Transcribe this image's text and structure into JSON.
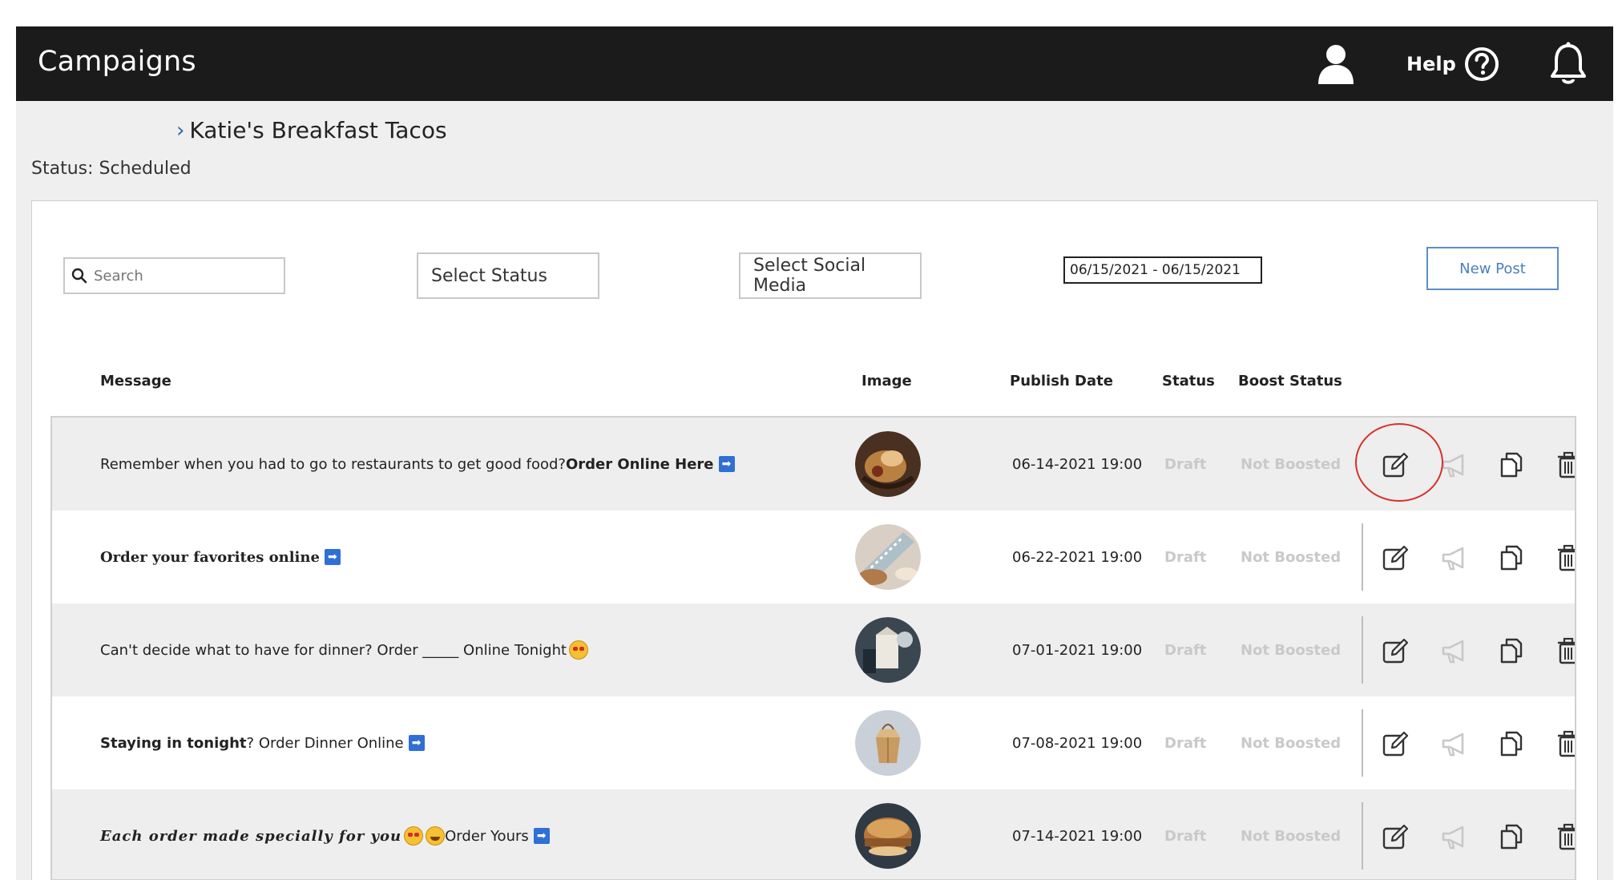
{
  "header": {
    "title": "Campaigns",
    "help_label": "Help",
    "user_icon": "user-icon",
    "help_icon": "help-circle-icon",
    "bell_icon": "bell-icon"
  },
  "campaign": {
    "name": "Katie's Breakfast Tacos",
    "status": "Status: Scheduled"
  },
  "filters": {
    "search_placeholder": "Search",
    "select_status": "Select Status",
    "select_social": "Select Social Media",
    "date_range": "06/15/2021 - 06/15/2021",
    "new_post": "New Post"
  },
  "columns": {
    "message": "Message",
    "image": "Image",
    "publish_date": "Publish Date",
    "status": "Status",
    "boost_status": "Boost Status"
  },
  "posts": [
    {
      "message_text": "Remember when you had to go to restaurants to get good food? ",
      "message_bold": "Order Online Here",
      "publish_date": "06-14-2021 19:00",
      "status": "Draft",
      "boost_status": "Not Boosted"
    },
    {
      "message_styled": "Order your favorites online",
      "publish_date": "06-22-2021 19:00",
      "status": "Draft",
      "boost_status": "Not Boosted"
    },
    {
      "message_text": "Can't decide what to have for dinner? Order _____ Online Tonight",
      "publish_date": "07-01-2021 19:00",
      "status": "Draft",
      "boost_status": "Not Boosted"
    },
    {
      "message_bold": "Staying in tonight",
      "message_text": "? Order Dinner Online",
      "publish_date": "07-08-2021 19:00",
      "status": "Draft",
      "boost_status": "Not Boosted"
    },
    {
      "message_styled": "Each order made specially for you",
      "message_text": " Order Yours",
      "publish_date": "07-14-2021 19:00",
      "status": "Draft",
      "boost_status": "Not Boosted"
    }
  ],
  "colors": {
    "topbar": "#1b1b1b",
    "accent": "#4a7fbf",
    "highlight": "#d8302b",
    "muted_status": "#c9c9c9"
  }
}
